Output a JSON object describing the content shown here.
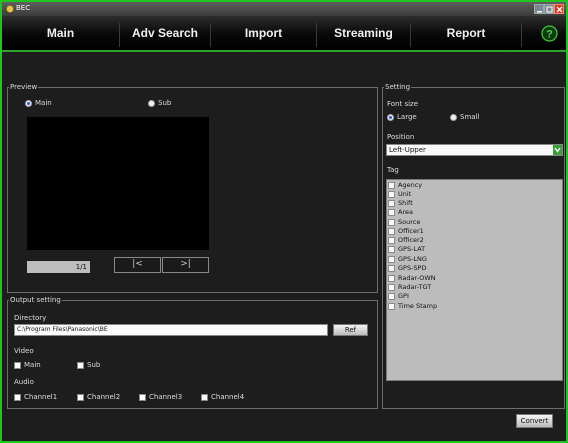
{
  "window": {
    "title": "BEC"
  },
  "menu": {
    "items": [
      "Main",
      "Adv Search",
      "Import",
      "Streaming",
      "Report"
    ],
    "help_label": "?"
  },
  "preview": {
    "title": "Preview",
    "options": [
      "Main",
      "Sub"
    ],
    "selected": "Main",
    "counter": "1/1",
    "prev_label": "|<",
    "next_label": ">|"
  },
  "output_setting": {
    "title": "Output setting",
    "directory_label": "Directory",
    "directory_value": "C:\\Program Files\\Panasonic\\BE",
    "ref_label": "Ref",
    "video_label": "Video",
    "video_options": [
      "Main",
      "Sub"
    ],
    "audio_label": "Audio",
    "audio_options": [
      "Channel1",
      "Channel2",
      "Channel3",
      "Channel4"
    ]
  },
  "setting": {
    "title": "Setting",
    "font_size_label": "Font size",
    "font_size_options": [
      "Large",
      "Small"
    ],
    "font_size_selected": "Large",
    "position_label": "Position",
    "position_value": "Left-Upper",
    "tag_label": "Tag",
    "tags": [
      "Agency",
      "Unit",
      "Shift",
      "Area",
      "Source",
      "Officer1",
      "Officer2",
      "GPS-LAT",
      "GPS-LNG",
      "GPS-SPD",
      "Radar-OWN",
      "Radar-TGT",
      "GPI",
      "Time Stamp"
    ]
  },
  "convert_label": "Convert",
  "colors": {
    "accent_green": "#1ec51e",
    "panel_bg": "#1d1d1d",
    "menu_bg": "#000000",
    "selection_blue": "#2a5fd8"
  }
}
